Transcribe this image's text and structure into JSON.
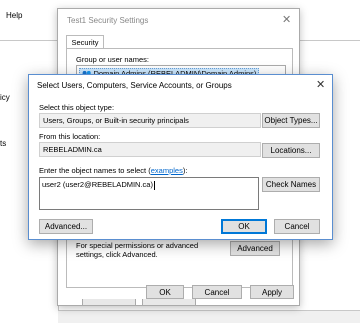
{
  "background": {
    "menu_help": "Help",
    "left_text_1": "icy",
    "left_text_2": "ts"
  },
  "security_window": {
    "title": "Test1 Security Settings",
    "close_glyph": "✕",
    "tab_label": "Security",
    "group_label": "Group or user names:",
    "group_item": "Domain Admins (REBELADMIN\\Domain Admins)",
    "advanced_text": "For special permissions or advanced settings, click Advanced.",
    "advanced_button": "Advanced",
    "ok_button": "OK",
    "cancel_button": "Cancel",
    "apply_button": "Apply"
  },
  "select_dialog": {
    "title": "Select Users, Computers, Service Accounts, or Groups",
    "close_glyph": "✕",
    "object_type_label": "Select this object type:",
    "object_type_value": "Users, Groups, or Built-in security principals",
    "object_types_button": "Object Types...",
    "location_label": "From this location:",
    "location_value": "REBELADMIN.ca",
    "locations_button": "Locations...",
    "names_label_prefix": "Enter the object names to select (",
    "names_label_link": "examples",
    "names_label_suffix": "):",
    "names_value": "user2 (user2@REBELADMIN.ca)",
    "check_names_button": "Check Names",
    "advanced_button": "Advanced...",
    "ok_button": "OK",
    "cancel_button": "Cancel"
  },
  "colors": {
    "dialog_border": "#5a8ed0",
    "link": "#0066cc",
    "focus": "#0078d7"
  }
}
